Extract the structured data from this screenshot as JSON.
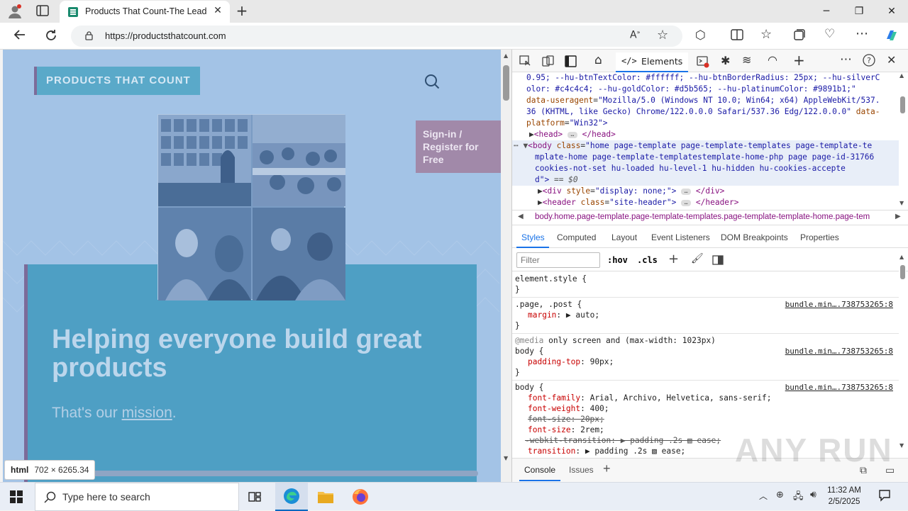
{
  "browser": {
    "tab_title": "Products That Count-The Leader",
    "url": "https://productsthatcount.com"
  },
  "page": {
    "logo": "PRODUCTS THAT COUNT",
    "signin": "Sign-in / Register for Free",
    "hero_title": "Helping everyone build great products",
    "hero_sub_prefix": "That's our ",
    "hero_sub_link": "mission",
    "hero_sub_suffix": ".",
    "size_tip_tag": "html",
    "size_tip_dims": "702 × 6265.34"
  },
  "devtools": {
    "elements_tab": "Elements",
    "dom": {
      "line1": "0.95; --hu-btnTextColor: #ffffff; --hu-btnBorderRadius: 25px; --hu-silverC",
      "line2": "olor: #c4c4c4; --hu-goldColor: #d5b565; --hu-platinumColor: #9891b1;\"",
      "line3_attr": "data-useragent",
      "line3_val": "\"Mozilla/5.0 (Windows NT 10.0; Win64; x64) AppleWebKit/537.",
      "line4_val": "36 (KHTML, like Gecko) Chrome/122.0.0.0 Safari/537.36 Edg/122.0.0.0\"",
      "line4_attr": "data-",
      "line5_attr": "platform",
      "line5_val": "\"Win32\">",
      "head": "<head>",
      "head_close": "</head>",
      "body_open": "<body",
      "body_class_attr": "class",
      "body_class_1": "\"home page-template page-template-templates page-template-te",
      "body_class_2": "mplate-home page-template-templatestemplate-home-php page page-id-31766",
      "body_class_3": "cookies-not-set hu-loaded hu-level-1 hu-hidden hu-cookies-accepte",
      "body_class_4": "d\">",
      "body_eq": "== $0",
      "div_open": "<div",
      "div_style_attr": "style",
      "div_style_val": "\"display: none;\">",
      "div_close": "</div>",
      "header_open": "<header",
      "header_class_attr": "class",
      "header_class_val": "\"site-header\">",
      "header_close": "</header>"
    },
    "breadcrumb": "body.home.page-template.page-template-templates.page-template-template-home.page-tem",
    "styles_tabs": [
      "Styles",
      "Computed",
      "Layout",
      "Event Listeners",
      "DOM Breakpoints",
      "Properties"
    ],
    "filter_placeholder": "Filter",
    "hov": ":hov",
    "cls": ".cls",
    "styles": {
      "element_style": "element.style {",
      "close": "}",
      "page_post": ".page, .post {",
      "margin_prop": "margin",
      "margin_val": "auto;",
      "media_kw": "@media",
      "media_rule": "only screen and (max-width: 1023px)",
      "body_sel": "body {",
      "padding_top_prop": "padding-top",
      "padding_top_val": "90px;",
      "font_family_prop": "font-family",
      "font_family_val": "Arial, Archivo, Helvetica, sans-serif;",
      "font_weight_prop": "font-weight",
      "font_weight_val": "400;",
      "font_size_strike": "font-size: 20px;",
      "font_size_prop": "font-size",
      "font_size_val": "2rem;",
      "webkit_strike": "-webkit-transition: ▶ padding .2s ▧ ease;",
      "transition_prop": "transition",
      "transition_val": "▶ padding .2s ▧ ease;",
      "source": "bundle.min….738753265:8"
    },
    "drawer": {
      "console": "Console",
      "issues": "Issues"
    }
  },
  "taskbar": {
    "search_placeholder": "Type here to search",
    "time": "11:32 AM",
    "date": "2/5/2025"
  },
  "watermark": "ANY RUN",
  "colors": {
    "page_bg": "#a3c3e6",
    "hero_bg": "#4e9fc4",
    "logo_bg": "#5aa9c9",
    "signin_bg": "#a189a9",
    "accent": "#1a73e8"
  }
}
